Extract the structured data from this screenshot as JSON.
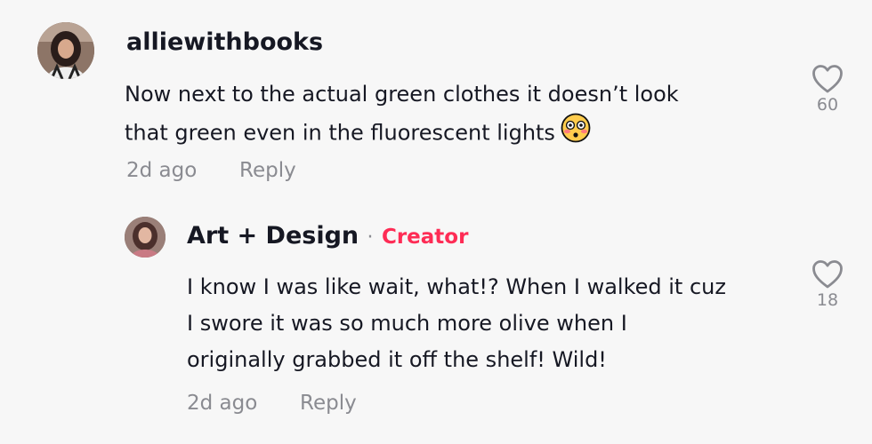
{
  "comments": [
    {
      "username": "alliewithbooks",
      "text_lines": [
        "Now next to the actual green clothes it doesn’t look",
        "that green even in the fluorescent lights"
      ],
      "emoji": "flushed-face",
      "time": "2d ago",
      "reply_label": "Reply",
      "likes": "60"
    }
  ],
  "replies": [
    {
      "username": "Art + Design",
      "separator": "·",
      "badge": "Creator",
      "text_lines": [
        "I know I was like wait, what!? When I walked it cuz",
        "I swore it was so much more olive when I",
        "originally grabbed it off the shelf! Wild!"
      ],
      "time": "2d ago",
      "reply_label": "Reply",
      "likes": "18"
    }
  ],
  "colors": {
    "background": "#f7f7f7",
    "text": "#161823",
    "muted": "#8a8b91",
    "creator_badge": "#fe2c55"
  }
}
